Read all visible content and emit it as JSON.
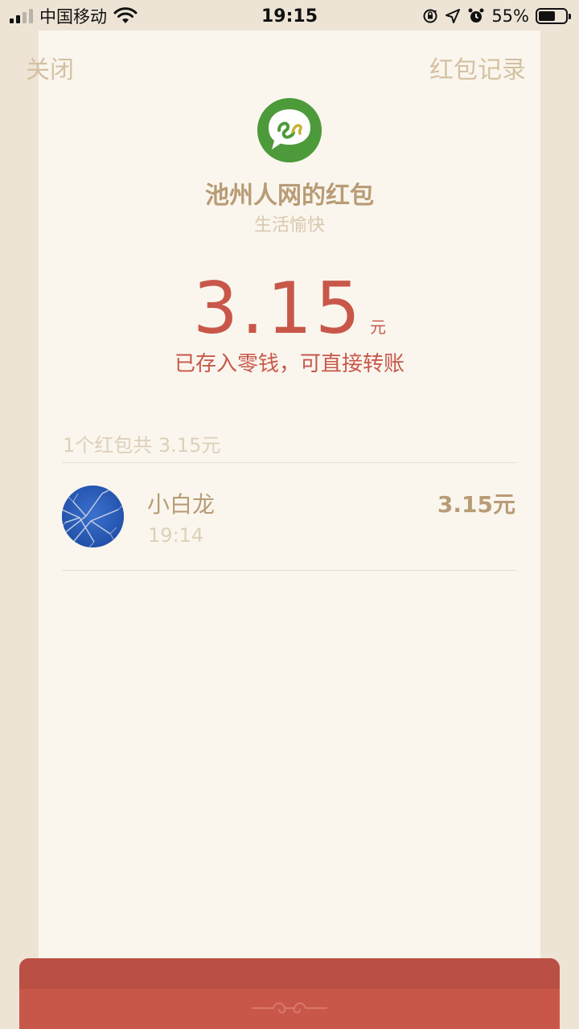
{
  "status_bar": {
    "carrier": "中国移动",
    "time": "19:15",
    "battery_percent": "55%",
    "battery_level": 0.55,
    "icons": [
      "signal-icon",
      "wifi-icon",
      "rotation-lock-icon",
      "location-icon",
      "alarm-icon",
      "battery-icon"
    ]
  },
  "header": {
    "close_label": "关闭",
    "record_label": "红包记录"
  },
  "envelope": {
    "logo_icon": "chat-bubble-logo-icon",
    "sender_title": "池州人网的红包",
    "greeting": "生活愉快",
    "amount": "3.15",
    "unit": "元",
    "saved_note": "已存入零钱，可直接转账"
  },
  "summary": {
    "text": "1个红包共 3.15元"
  },
  "receivers": [
    {
      "name": "小白龙",
      "time": "19:14",
      "amount": "3.15元"
    }
  ],
  "colors": {
    "accent_red": "#c8574a",
    "gold_text": "#b89c76",
    "pale_text": "#ddd0b9",
    "card_bg": "#faf6ee",
    "page_bg": "#ede4d6",
    "logo_green": "#4c9a3a"
  }
}
